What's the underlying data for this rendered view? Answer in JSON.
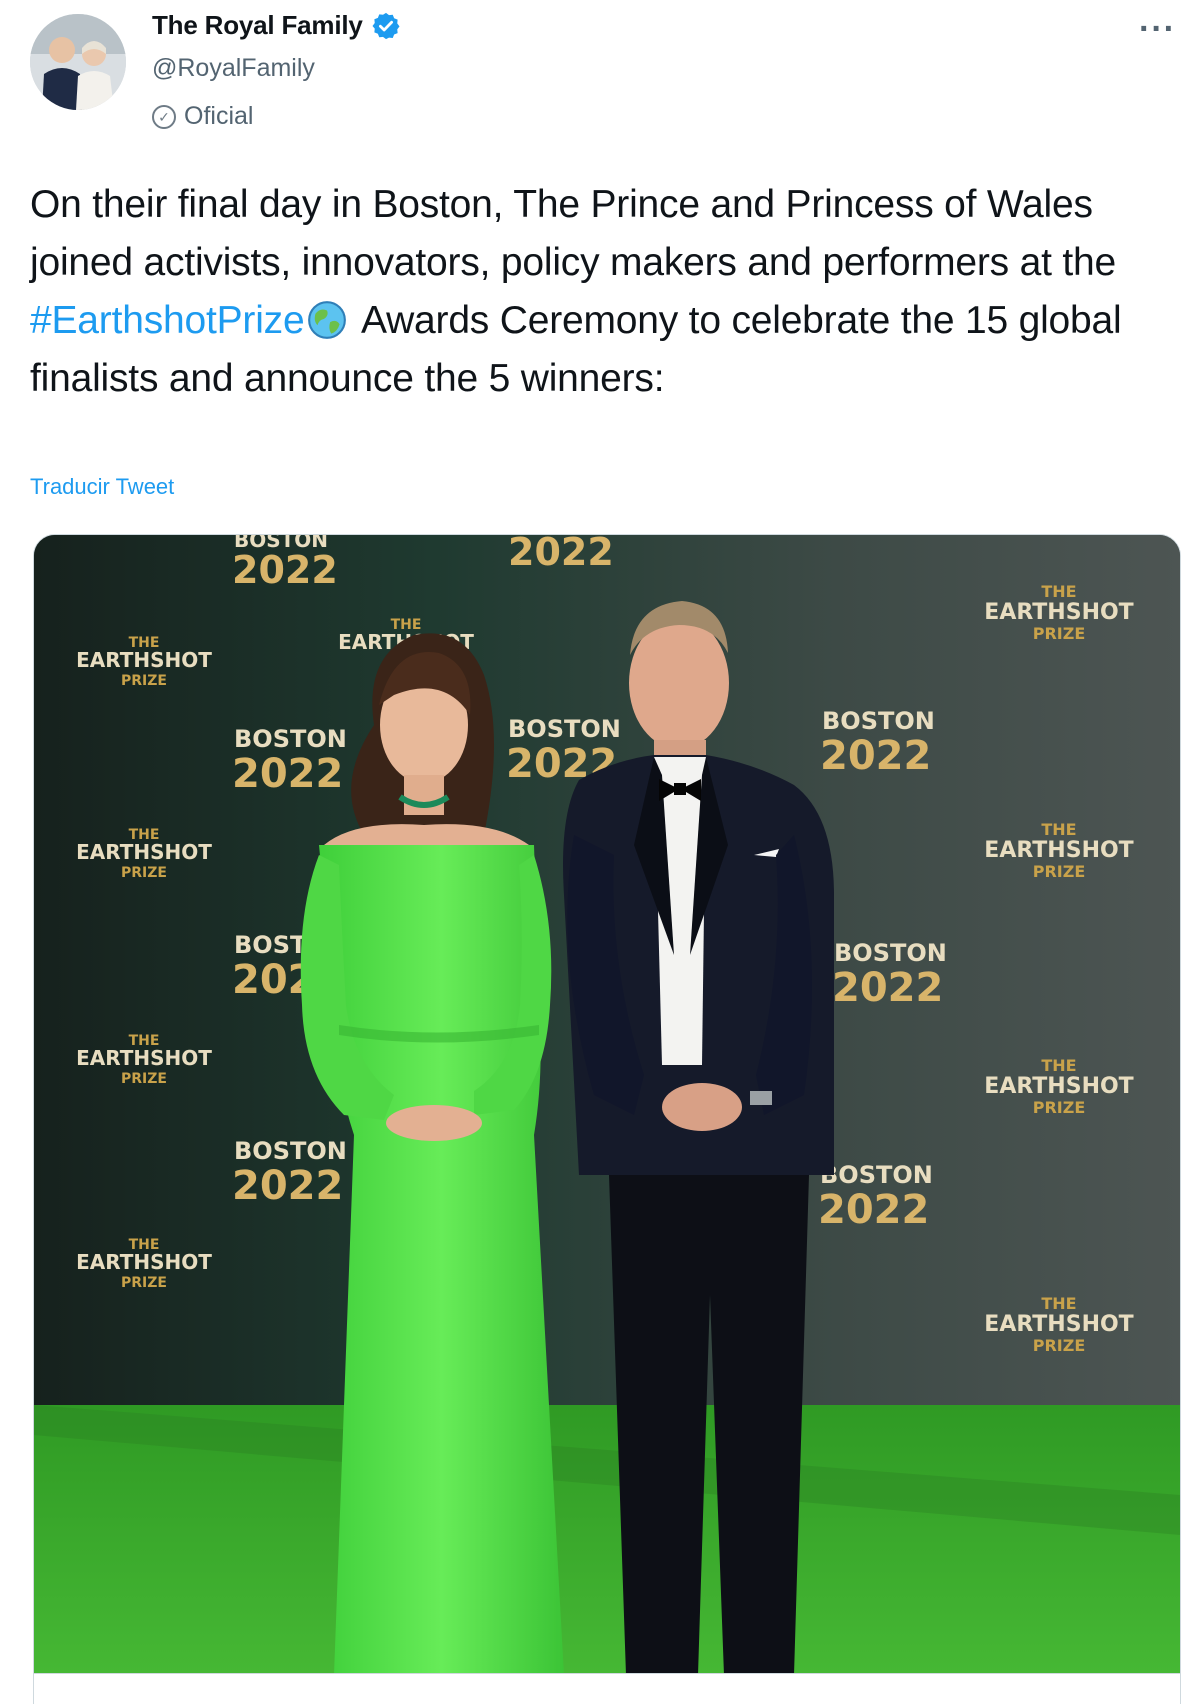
{
  "account": {
    "display_name": "The Royal Family",
    "handle": "@RoyalFamily",
    "label": "Oficial",
    "verified_color": "#1d9bf0"
  },
  "menu": {
    "more_label": "···"
  },
  "tweet": {
    "text_before": "On their final day in Boston, The Prince and Princess of Wales joined activists, innovators, policy makers and performers at the ",
    "hashtag": "#EarthshotPrize",
    "text_after": " Awards Ceremony to celebrate the 15 global finalists and announce the 5 winners:",
    "translate_label": "Traducir Tweet"
  },
  "media": {
    "backdrop_words": {
      "the": "THE",
      "earthshot": "EARTHSHOT",
      "prize": "PRIZE",
      "boston": "BOSTON",
      "year": "2022"
    }
  },
  "colors": {
    "link": "#1d9bf0",
    "carpet": "#3fae2a",
    "dress": "#55e04a"
  }
}
